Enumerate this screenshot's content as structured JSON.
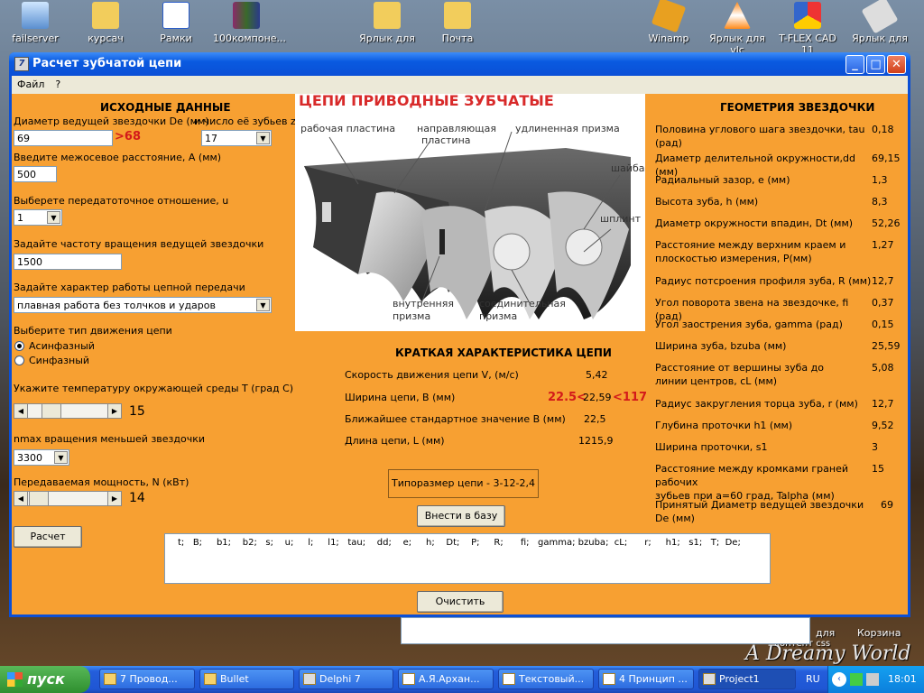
{
  "desktop": {
    "icons": [
      {
        "label": "failserver",
        "icon": "computer-icon"
      },
      {
        "label": "курсач",
        "icon": "folder-icon"
      },
      {
        "label": "Рамки",
        "icon": "word-doc-icon"
      },
      {
        "label": "100компоне...",
        "icon": "winrar-icon"
      },
      {
        "label": "Ярлык для",
        "icon": "folder-shortcut-icon"
      },
      {
        "label": "Почта",
        "icon": "folder-shortcut-icon"
      },
      {
        "label": "Winamp",
        "icon": "winamp-icon"
      },
      {
        "label": "Ярлык для vlc",
        "icon": "vlc-icon"
      },
      {
        "label": "T-FLEX CAD 11",
        "icon": "tflex-icon"
      },
      {
        "label": "Ярлык для",
        "icon": "shortcut-icon"
      }
    ],
    "right_labels": {
      "korzina": "Корзина",
      "dlya": "для",
      "css": "контент css"
    },
    "watermark": "A Dreamy World"
  },
  "window": {
    "title": "Расчет зубчатой цепи",
    "menu": [
      "Файл",
      "?"
    ]
  },
  "left": {
    "header": "ИСХОДНЫЕ ДАННЫЕ",
    "diameter_label": "Диаметр ведущей звездочки De (мм)",
    "teeth_label": "и число её зубьев z",
    "diameter_value": "69",
    "diameter_hint": ">68",
    "teeth_value": "17",
    "distance_label": "Введите межосевое расстояние, A (мм)",
    "distance_value": "500",
    "ratio_label": "Выберете передатоточное отношение, u",
    "ratio_value": "1",
    "freq_label": "Задайте частоту вращения ведущей звездочки",
    "freq_value": "1500",
    "mode_label": "Задайте характер работы цепной передачи",
    "mode_value": "плавная работа без толчков и ударов",
    "motion_label": "Выберите тип движения цепи",
    "radio_async": "Асинфазный",
    "radio_sync": "Синфазный",
    "temp_label": "Укажите температуру окружающей среды Т (град С)",
    "temp_value": "15",
    "nmax_label": "nmax вращения меньшей звездочки",
    "nmax_value": "3300",
    "power_label": "Передаваемая мощность, N (кВт)",
    "power_value": "14",
    "calc_button": "Расчет"
  },
  "image": {
    "title": "ЦЕПИ ПРИВОДНЫЕ ЗУБЧАТЫЕ",
    "labels": {
      "plate": "рабочая пластина",
      "guide1": "направляющая",
      "guide2": "пластина",
      "prism": "удлиненная призма",
      "washer": "шайба",
      "pin": "шплинт",
      "inner1": "внутренняя",
      "inner2": "призма",
      "conn1": "соединительная",
      "conn2": "призма"
    }
  },
  "summary": {
    "header": "КРАТКАЯ ХАРАКТЕРИСТИКА ЦЕПИ",
    "rows": [
      {
        "label": "Скорость движения цепи V, (м/с)",
        "value": "5,42"
      },
      {
        "label": "Ширина цепи, B (мм)",
        "value": "22,59"
      },
      {
        "label": "Ближайшее стандартное значение В (мм)",
        "value": "22,5"
      },
      {
        "label": "Длина цепи, L (мм)",
        "value": "1215,9"
      }
    ],
    "width_min": "22.5<",
    "width_max": "<117",
    "size_label": "Типоразмер цепи - 3-12-2,4",
    "save_button": "Внести в базу"
  },
  "geometry": {
    "header": "ГЕОМЕТРИЯ ЗВЕЗДОЧКИ",
    "rows": [
      {
        "label": "Половина углового шага звездочки, tau (рад)",
        "value": "0,18"
      },
      {
        "label": "Диаметр делительной окружности,dd (мм)",
        "value": "69,15"
      },
      {
        "label": "Радиальный зазор, e (мм)",
        "value": "1,3"
      },
      {
        "label": "Высота зуба, h (мм)",
        "value": "8,3"
      },
      {
        "label": "Диаметр окружности впадин, Dt (мм)",
        "value": "52,26"
      },
      {
        "label": "Расстояние между верхним краем и",
        "label2": "плоскостью измерения, P(мм)",
        "value": "1,27"
      },
      {
        "label": "Радиус потсроения профиля зуба, R (мм)",
        "value": "12,7"
      },
      {
        "label": "Угол поворота звена на звездочке, fi (рад)",
        "value": "0,37"
      },
      {
        "label": "Угол заострения зуба, gamma (рад)",
        "value": "0,15"
      },
      {
        "label": "Ширина зуба, bzuba (мм)",
        "value": "25,59"
      },
      {
        "label": "Расстояние от вершины зуба до",
        "label2": "линии центров, cL (мм)",
        "value": "5,08"
      },
      {
        "label": "Радиус закругления торца зуба, r (мм)",
        "value": "12,7"
      },
      {
        "label": "Глубина проточки h1 (мм)",
        "value": "9,52"
      },
      {
        "label": "Ширина проточки, s1",
        "value": "3"
      },
      {
        "label": "Расстояние между кромками граней рабочих",
        "label2": "зубьев при a=60 град, Talpha (мм)",
        "value": "15"
      },
      {
        "label": "Принятый Диаметр ведущей звездочки De (мм)",
        "value": "69"
      }
    ]
  },
  "memo": {
    "text": "t;   B;     b1;    b2;   s;    u;     l;     l1;   tau;    dd;    e;     h;    Dt;    P;     R;      fi;   gamma; bzuba;  cL;      r;     h1;   s1;   T;  De;",
    "clear_button": "Очистить"
  },
  "taskbar": {
    "start": "пуск",
    "tasks": [
      "7 Провод...",
      "Bullet",
      "Delphi 7",
      "А.Я.Архан...",
      "Текстовый...",
      "4 Принцип ...",
      "Project1"
    ],
    "lang": "RU",
    "clock": "18:01"
  }
}
